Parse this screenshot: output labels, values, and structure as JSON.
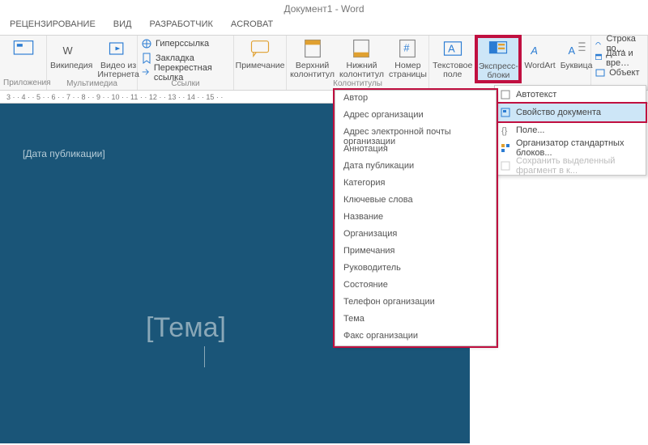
{
  "title": "Документ1 - Word",
  "tabs": [
    "РЕЦЕНЗИРОВАНИЕ",
    "ВИД",
    "РАЗРАБОТЧИК",
    "ACROBAT"
  ],
  "groups": {
    "g0": {
      "title": "Приложения",
      "b0": ""
    },
    "g1": {
      "title": "Мультимедиа",
      "b0": "Википедия",
      "b1": "Видео из Интернета"
    },
    "g2": {
      "title": "Ссылки",
      "b0": "Гиперссылка",
      "b1": "Закладка",
      "b2": "Перекрестная ссылка"
    },
    "g3": {
      "title": "",
      "b0": "Примечание"
    },
    "g4": {
      "title": "Колонтитулы",
      "b0": "Верхний колонтитул",
      "b1": "Нижний колонтитул",
      "b2": "Номер страницы"
    },
    "g5": {
      "title": "",
      "b0": "Текстовое поле",
      "b1": "Экспресс-блоки",
      "b2": "WordArt",
      "b3": "Буквица"
    },
    "g6": {
      "title": "",
      "b0": "Строка по…",
      "b1": "Дата и вре…",
      "b2": "Объект"
    }
  },
  "ruler": "3 · · 4 · · 5 · · 6 · · 7 · · 8 · · 9 · · 10 · · 11 · · 12 · · 13 · · 14 · · 15 · · ",
  "page": {
    "ph1": "[Дата публикации]",
    "ph2": "[Тема]"
  },
  "menu_quickparts": {
    "m0": "Автотекст",
    "m1": "Свойство документа",
    "m2": "Поле...",
    "m3": "Организатор стандартных блоков...",
    "m4": "Сохранить выделенный фрагмент в к..."
  },
  "menu_docprops": [
    "Автор",
    "Адрес организации",
    "Адрес электронной почты организации",
    "Аннотация",
    "Дата публикации",
    "Категория",
    "Ключевые слова",
    "Название",
    "Организация",
    "Примечания",
    "Руководитель",
    "Состояние",
    "Телефон организации",
    "Тема",
    "Факс организации"
  ]
}
